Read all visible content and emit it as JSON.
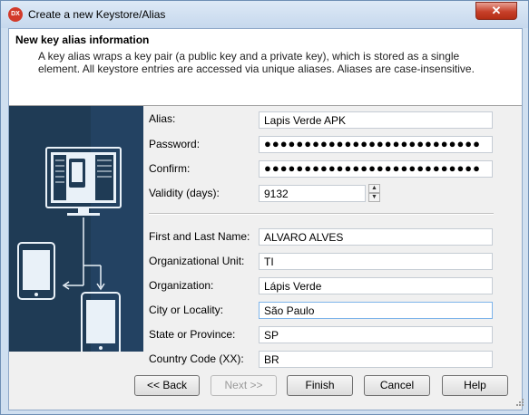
{
  "window": {
    "title": "Create a new Keystore/Alias",
    "app_icon": "DX",
    "close_glyph": "✕"
  },
  "header": {
    "title": "New key alias information",
    "description": "A key alias wraps a key pair (a public key and a private key), which is stored as a single element. All keystore entries are accessed via unique aliases. Aliases are case-insensitive."
  },
  "side_panel": {
    "illustration": "desktop-to-mobile-devices-illustration",
    "background_color": "#1f3b55"
  },
  "form": {
    "alias": {
      "label": "Alias:",
      "value": "Lapis Verde APK"
    },
    "password": {
      "label": "Password:",
      "value": "●●●●●●●●●●●●●●●●●●●●●●●●●●●"
    },
    "confirm": {
      "label": "Confirm:",
      "value": "●●●●●●●●●●●●●●●●●●●●●●●●●●●"
    },
    "validity": {
      "label": "Validity (days):",
      "value": "9132",
      "up_icon": "▲",
      "down_icon": "▼"
    },
    "first_last_name": {
      "label": "First and Last Name:",
      "value": "ALVARO ALVES"
    },
    "org_unit": {
      "label": "Organizational Unit:",
      "value": "TI"
    },
    "organization": {
      "label": "Organization:",
      "value": "Lápis Verde"
    },
    "city": {
      "label": "City or Locality:",
      "value": "São Paulo"
    },
    "state": {
      "label": "State or Province:",
      "value": "SP"
    },
    "country": {
      "label": "Country Code (XX):",
      "value": "BR"
    }
  },
  "buttons": {
    "back": "<< Back",
    "next": "Next >>",
    "finish": "Finish",
    "cancel": "Cancel",
    "help": "Help"
  }
}
